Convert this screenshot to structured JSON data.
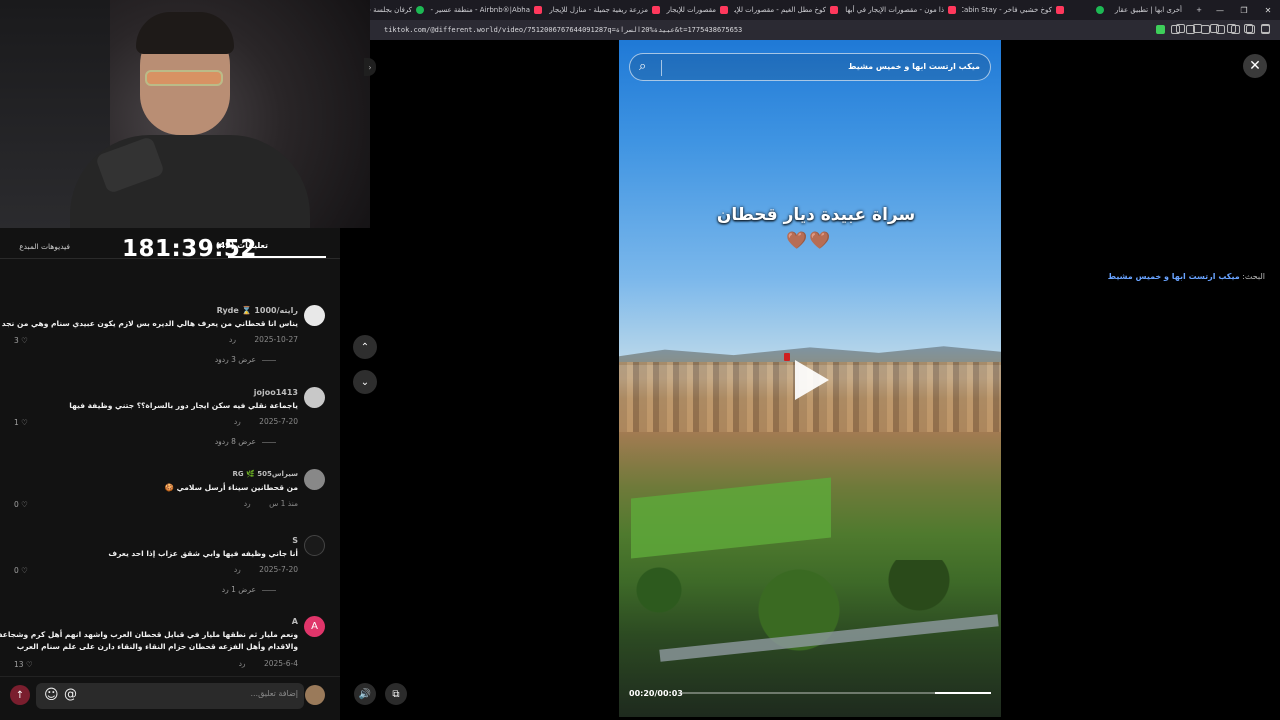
{
  "browser": {
    "tabs": [
      {
        "label": "أخرى ابها | تطبيق عقار",
        "favicon": "none"
      },
      {
        "label": "",
        "favicon": "plain"
      },
      {
        "label": "كوخ خشبي فاخر - Luxury Cabin Stay",
        "favicon": "airbnb"
      },
      {
        "label": "ذا مون - مقصورات الإيجار في أبها و",
        "favicon": "airbnb"
      },
      {
        "label": "كوخ مطل الغيم - مقصورات للإيجار",
        "favicon": "airbnb"
      },
      {
        "label": "مقصورات للإيجار في",
        "favicon": "airbnb"
      },
      {
        "label": "مزرعة ريفية جميلة - منازل للإيجار في",
        "favicon": "airbnb"
      },
      {
        "label": "Airbnb®|Abha - منطقة عسير - نافة",
        "favicon": "airbnb"
      },
      {
        "label": "كرفان بجلسة خارجية وأجواء ممتعة -",
        "favicon": "plain"
      }
    ],
    "new_tab": "+",
    "url": "tiktok.com/@different.world/video/7512006767644091287q=عبيدة%20السراة&t=1775438675653"
  },
  "stream": {
    "timer": "181:39:52"
  },
  "comments_panel": {
    "tab_comments": "تعليقات (49)",
    "tab_creator_videos": "فيديوهات المبدع",
    "search_prefix": "البحث:",
    "search_query": "ميكب ارتست ابها و خميس مشيط",
    "comments": [
      {
        "user": "رايته/1000 ⌛ Ryde",
        "text": "يناس انا قحطاني من يعرف هالي الديره بس لازم يكون عبيدي سنام وهي من نجد",
        "date": "2025-10-27",
        "reply": "رد",
        "more": "عرض 3 ردود",
        "likes": "3"
      },
      {
        "user": "jojoo1413",
        "text": "ياجماعة نقلي فيه سكن ايجار دور بالسراة؟؟ جتني وظيفة فيها",
        "date": "2025-7-20",
        "reply": "رد",
        "more": "عرض 8 ردود",
        "likes": "1"
      },
      {
        "user": "سيراس505 🌿 RG",
        "text": "من قحطانين سيناء أرسل سلامي 🍪",
        "date": "منذ 1 س",
        "reply": "رد",
        "more": "",
        "likes": "0"
      },
      {
        "user": "S",
        "text": "أنا جاني وظيفه فيها وابي شقق عزاب إذا احد يعرف",
        "date": "2025-7-20",
        "reply": "رد",
        "more": "عرض 1 رد",
        "likes": "0"
      },
      {
        "user": "A",
        "text": "ونعم مليار ثم نطقها مليار في قبايل قحطان العرب واشهد انهم أهل كرم وشجاعة",
        "text2": "والاقدام وأهل الفزعه قحطان حزام النقاء والنقاء دارن على علم سنام العرب",
        "date": "2025-6-4",
        "reply": "رد",
        "more": "",
        "likes": "13"
      }
    ],
    "input_placeholder": "إضافة تعليق...",
    "send_icon": "↑",
    "emoji_icon": "☺",
    "at_icon": "@"
  },
  "video": {
    "search_text": "ميكب ارتست ابها و خميس مشيط",
    "overlay_title": "سراة عبيدة ديار قحطان",
    "hearts": [
      "🤎",
      "🤎"
    ],
    "time": "00:20/00:03",
    "progress": 0.18,
    "close_icon": "✕",
    "up_icon": "⌃",
    "down_icon": "⌄",
    "volume_icon": "🔊",
    "share_icon": "⧉"
  }
}
